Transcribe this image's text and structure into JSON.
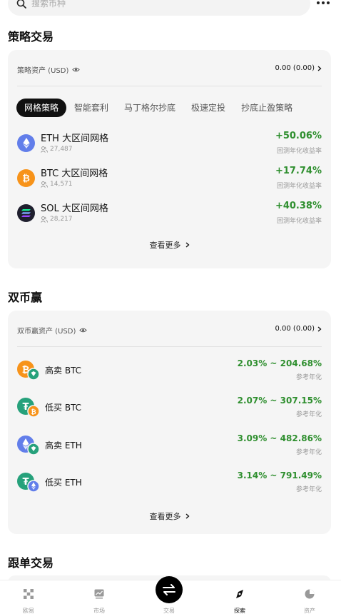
{
  "search": {
    "placeholder": "搜索币种"
  },
  "strategy": {
    "section_title": "策略交易",
    "asset_label": "策略资产 (USD)",
    "asset_value": "0.00 (0.00)",
    "tabs": [
      {
        "label": "网格策略",
        "active": true
      },
      {
        "label": "智能套利",
        "active": false
      },
      {
        "label": "马丁格尔抄底",
        "active": false
      },
      {
        "label": "极速定投",
        "active": false
      },
      {
        "label": "抄底止盈策略",
        "active": false
      }
    ],
    "items": [
      {
        "coin": "ETH",
        "name": "ETH 大区间网格",
        "users": "27,487",
        "pct": "+50.06%",
        "sub": "回测年化收益率",
        "color": "#627eea"
      },
      {
        "coin": "BTC",
        "name": "BTC 大区间网格",
        "users": "14,571",
        "pct": "+17.74%",
        "sub": "回测年化收益率",
        "color": "#f7931a"
      },
      {
        "coin": "SOL",
        "name": "SOL 大区间网格",
        "users": "28,217",
        "pct": "+40.38%",
        "sub": "回测年化收益率",
        "color": "#1f1f2e"
      }
    ],
    "view_more": "查看更多"
  },
  "dual": {
    "section_title": "双币赢",
    "asset_label": "双币赢资产 (USD)",
    "asset_value": "0.00 (0.00)",
    "items": [
      {
        "name": "高卖 BTC",
        "pct": "2.03% ~ 204.68%",
        "sub": "参考年化",
        "main": "btc"
      },
      {
        "name": "低买 BTC",
        "pct": "2.07% ~ 307.15%",
        "sub": "参考年化",
        "main": "usdt-btc"
      },
      {
        "name": "高卖 ETH",
        "pct": "3.09% ~ 482.86%",
        "sub": "参考年化",
        "main": "eth"
      },
      {
        "name": "低买 ETH",
        "pct": "3.14% ~ 791.49%",
        "sub": "参考年化",
        "main": "usdt-eth"
      }
    ],
    "view_more": "查看更多"
  },
  "copy": {
    "section_title": "跟单交易"
  },
  "nav": {
    "items": [
      {
        "label": "欧易",
        "icon": "okx-logo-icon"
      },
      {
        "label": "市场",
        "icon": "chart-icon"
      },
      {
        "label": "交易",
        "icon": "swap-icon"
      },
      {
        "label": "探索",
        "icon": "compass-icon",
        "active": true
      },
      {
        "label": "资产",
        "icon": "pie-icon"
      }
    ]
  },
  "colors": {
    "accent_green": "#2f8f2f",
    "card_bg": "#f5f5f5",
    "btc": "#f7931a",
    "eth": "#627eea",
    "usdt": "#26a17b"
  }
}
